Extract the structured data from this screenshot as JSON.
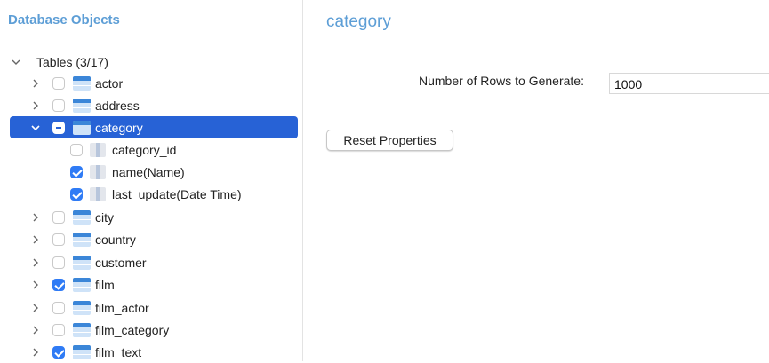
{
  "sidebar": {
    "title": "Database Objects",
    "tables_group_label": "Tables (3/17)",
    "tables": [
      {
        "label": "actor",
        "checked": false
      },
      {
        "label": "address",
        "checked": false
      },
      {
        "label": "category",
        "checked": "mixed",
        "selected": true,
        "columns": [
          {
            "label": "category_id",
            "checked": false
          },
          {
            "label": "name(Name)",
            "checked": true
          },
          {
            "label": "last_update(Date Time)",
            "checked": true
          }
        ]
      },
      {
        "label": "city",
        "checked": false
      },
      {
        "label": "country",
        "checked": false
      },
      {
        "label": "customer",
        "checked": false
      },
      {
        "label": "film",
        "checked": true
      },
      {
        "label": "film_actor",
        "checked": false
      },
      {
        "label": "film_category",
        "checked": false
      },
      {
        "label": "film_text",
        "checked": true
      }
    ]
  },
  "panel": {
    "title": "category",
    "rows_label": "Number of Rows to Generate:",
    "rows_value": "1000",
    "reset_label": "Reset Properties"
  },
  "colors": {
    "accent": "#2762d6",
    "title": "#5d9ed6",
    "checkbox": "#2f7bf5"
  }
}
